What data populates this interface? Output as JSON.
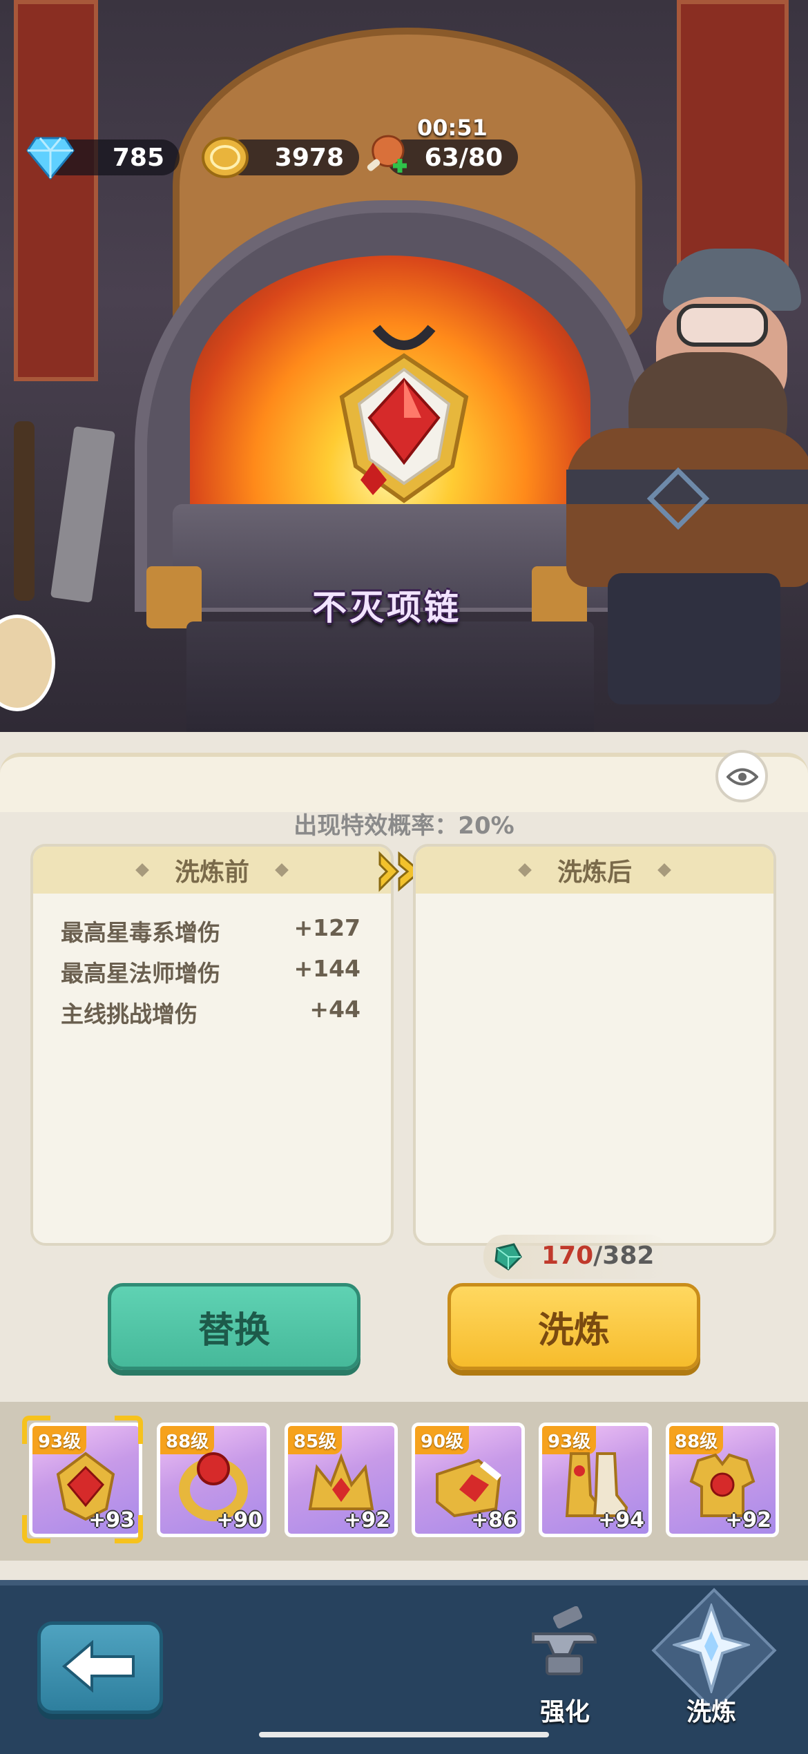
{
  "currency": {
    "gems": "785",
    "gold": "3978",
    "stamina": "63/80",
    "stamina_timer": "00:51"
  },
  "item": {
    "name": "不灭项链"
  },
  "panel": {
    "special_prob_label": "出现特效概率：20%",
    "before_title": "洗炼前",
    "after_title": "洗炼后",
    "before_stats": [
      {
        "name": "最高星毒系增伤",
        "value": "+127"
      },
      {
        "name": "最高星法师增伤",
        "value": "+144"
      },
      {
        "name": "主线挑战增伤",
        "value": "+44"
      }
    ],
    "cost_have": "170",
    "cost_need": "/382",
    "replace_button": "替换",
    "refine_button": "洗炼"
  },
  "equipment": [
    {
      "level": "93级",
      "bonus": "+93",
      "icon": "necklace-icon",
      "selected": true
    },
    {
      "level": "88级",
      "bonus": "+90",
      "icon": "ring-icon",
      "selected": false
    },
    {
      "level": "85级",
      "bonus": "+92",
      "icon": "helmet-icon",
      "selected": false
    },
    {
      "level": "90级",
      "bonus": "+86",
      "icon": "bracer-icon",
      "selected": false
    },
    {
      "level": "93级",
      "bonus": "+94",
      "icon": "boots-icon",
      "selected": false
    },
    {
      "level": "88级",
      "bonus": "+92",
      "icon": "armor-icon",
      "selected": false
    }
  ],
  "nav": {
    "enhance_label": "强化",
    "refine_label": "洗炼"
  },
  "colors": {
    "accent_green": "#46b99a",
    "accent_yellow": "#f6bc2c",
    "cost_red": "#c0392b",
    "nav_bg": "#27425e"
  }
}
